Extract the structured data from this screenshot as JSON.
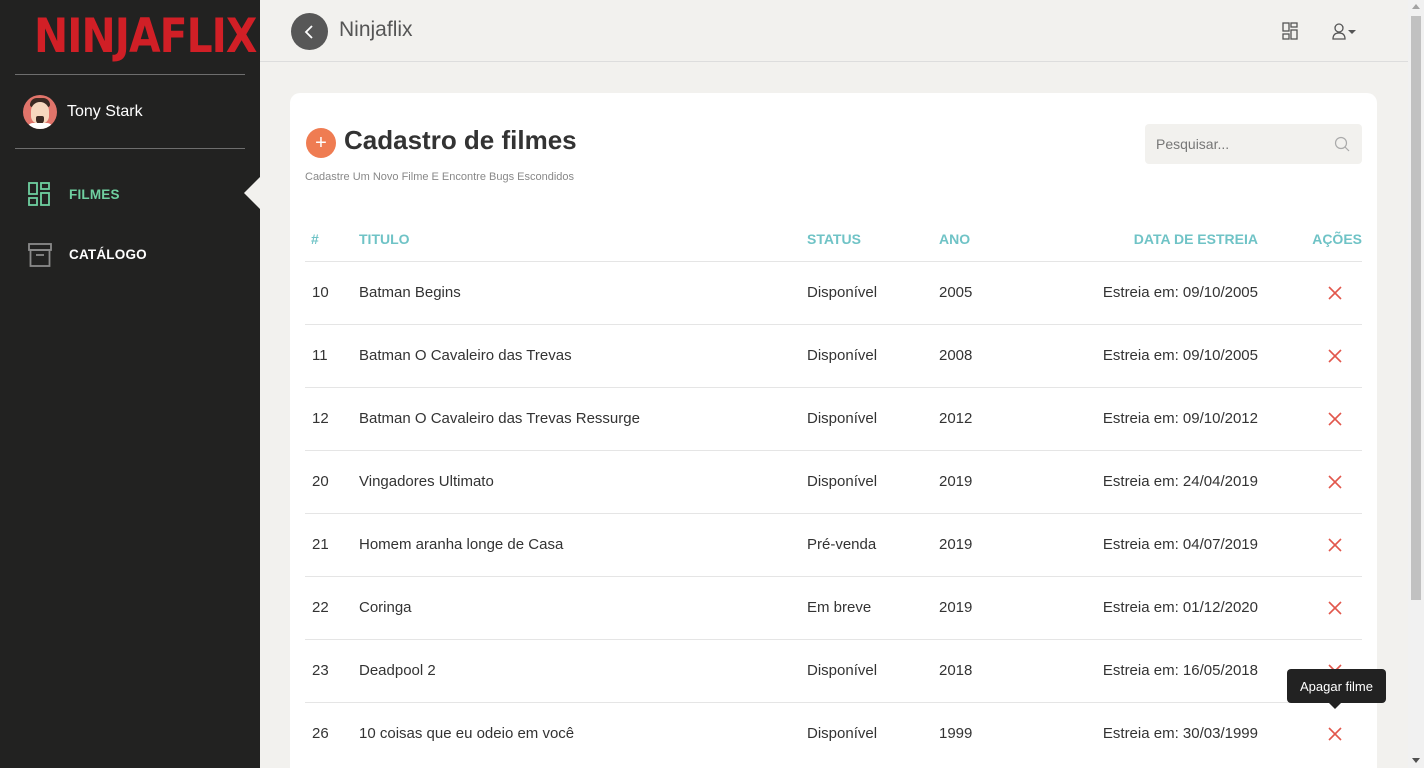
{
  "brand": {
    "logo_text": "NINJAFLIX",
    "logo_color": "#d11f26"
  },
  "user": {
    "name": "Tony Stark"
  },
  "sidebar": {
    "items": [
      {
        "label": "FILMES",
        "icon": "dashboard-icon",
        "active": true,
        "color": "#6fd0a0"
      },
      {
        "label": "CATÁLOGO",
        "icon": "archive-box-icon",
        "active": false,
        "color": "#ffffff"
      }
    ]
  },
  "header": {
    "title": "Ninjaflix",
    "icons": [
      "back-arrow-icon",
      "grid-icon",
      "user-icon"
    ]
  },
  "page": {
    "title": "Cadastro de filmes",
    "subtitle": "Cadastre Um Novo Filme E Encontre Bugs Escondidos",
    "add_label": "+",
    "search_placeholder": "Pesquisar..."
  },
  "table": {
    "headers": {
      "id": "#",
      "title": "TITULO",
      "status": "STATUS",
      "year": "ANO",
      "release": "DATA DE ESTREIA",
      "actions": "AÇÕES"
    },
    "rows": [
      {
        "id": "10",
        "title": "Batman Begins",
        "status": "Disponível",
        "year": "2005",
        "release": "Estreia em: 09/10/2005"
      },
      {
        "id": "11",
        "title": "Batman O Cavaleiro das Trevas",
        "status": "Disponível",
        "year": "2008",
        "release": "Estreia em: 09/10/2005"
      },
      {
        "id": "12",
        "title": "Batman O Cavaleiro das Trevas Ressurge",
        "status": "Disponível",
        "year": "2012",
        "release": "Estreia em: 09/10/2012"
      },
      {
        "id": "20",
        "title": "Vingadores Ultimato",
        "status": "Disponível",
        "year": "2019",
        "release": "Estreia em: 24/04/2019"
      },
      {
        "id": "21",
        "title": "Homem aranha longe de Casa",
        "status": "Pré-venda",
        "year": "2019",
        "release": "Estreia em: 04/07/2019"
      },
      {
        "id": "22",
        "title": "Coringa",
        "status": "Em breve",
        "year": "2019",
        "release": "Estreia em: 01/12/2020"
      },
      {
        "id": "23",
        "title": "Deadpool 2",
        "status": "Disponível",
        "year": "2018",
        "release": "Estreia em: 16/05/2018"
      },
      {
        "id": "26",
        "title": "10 coisas que eu odeio em você",
        "status": "Disponível",
        "year": "1999",
        "release": "Estreia em: 30/03/1999"
      }
    ]
  },
  "tooltip": {
    "text": "Apagar filme"
  },
  "colors": {
    "accent": "#6fc3c6",
    "add_button": "#ef7c52",
    "delete": "#e2574c",
    "sidebar_bg": "#222221"
  }
}
